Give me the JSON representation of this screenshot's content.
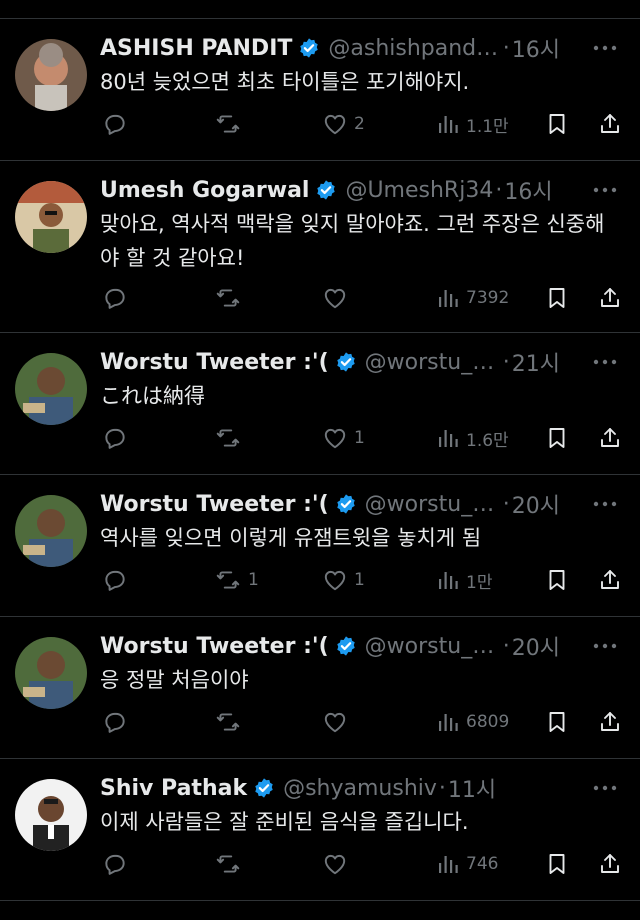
{
  "colors": {
    "background": "#000000",
    "text": "#e7e9ea",
    "muted": "#71767b",
    "verified": "#1d9bf0",
    "divider": "#2f3336"
  },
  "icons": {
    "reply": "reply-icon",
    "retweet": "retweet-icon",
    "like": "like-icon",
    "views": "views-icon",
    "bookmark": "bookmark-icon",
    "share": "share-icon",
    "more": "more-icon",
    "verified": "verified-badge-icon"
  },
  "tweets": [
    {
      "name": "ASHISH PANDIT",
      "handle": "@ashishpand29...",
      "sep": "·",
      "time": "16시",
      "text": "80년 늦었으면 최초 타이틀은 포기해야지.",
      "replies": "",
      "retweets": "",
      "likes": "2",
      "views": "1.1만"
    },
    {
      "name": "Umesh Gogarwal",
      "handle": "@UmeshRj34",
      "sep": "·",
      "time": "16시",
      "text": "맞아요, 역사적 맥락을 잊지 말아야죠. 그런 주장은 신중해야 할 것 같아요!",
      "replies": "",
      "retweets": "",
      "likes": "",
      "views": "7392"
    },
    {
      "name": "Worstu Tweeter :'(",
      "handle": "@worstu_twee...",
      "sep": "·",
      "time": "21시",
      "text": "これは納得",
      "replies": "",
      "retweets": "",
      "likes": "1",
      "views": "1.6만"
    },
    {
      "name": "Worstu Tweeter :'(",
      "handle": "@worstu_twee...",
      "sep": "·",
      "time": "20시",
      "text": "역사를 잊으면 이렇게 유잼트윗을 놓치게 됨",
      "replies": "",
      "retweets": "1",
      "likes": "1",
      "views": "1만"
    },
    {
      "name": "Worstu Tweeter :'(",
      "handle": "@worstu_twee...",
      "sep": "·",
      "time": "20시",
      "text": "응 정말 처음이야",
      "replies": "",
      "retweets": "",
      "likes": "",
      "views": "6809"
    },
    {
      "name": "Shiv Pathak",
      "handle": "@shyamushiv",
      "sep": "·",
      "time": "11시",
      "text": "이제 사람들은 잘 준비된 음식을 즐깁니다.",
      "replies": "",
      "retweets": "",
      "likes": "",
      "views": "746"
    }
  ]
}
